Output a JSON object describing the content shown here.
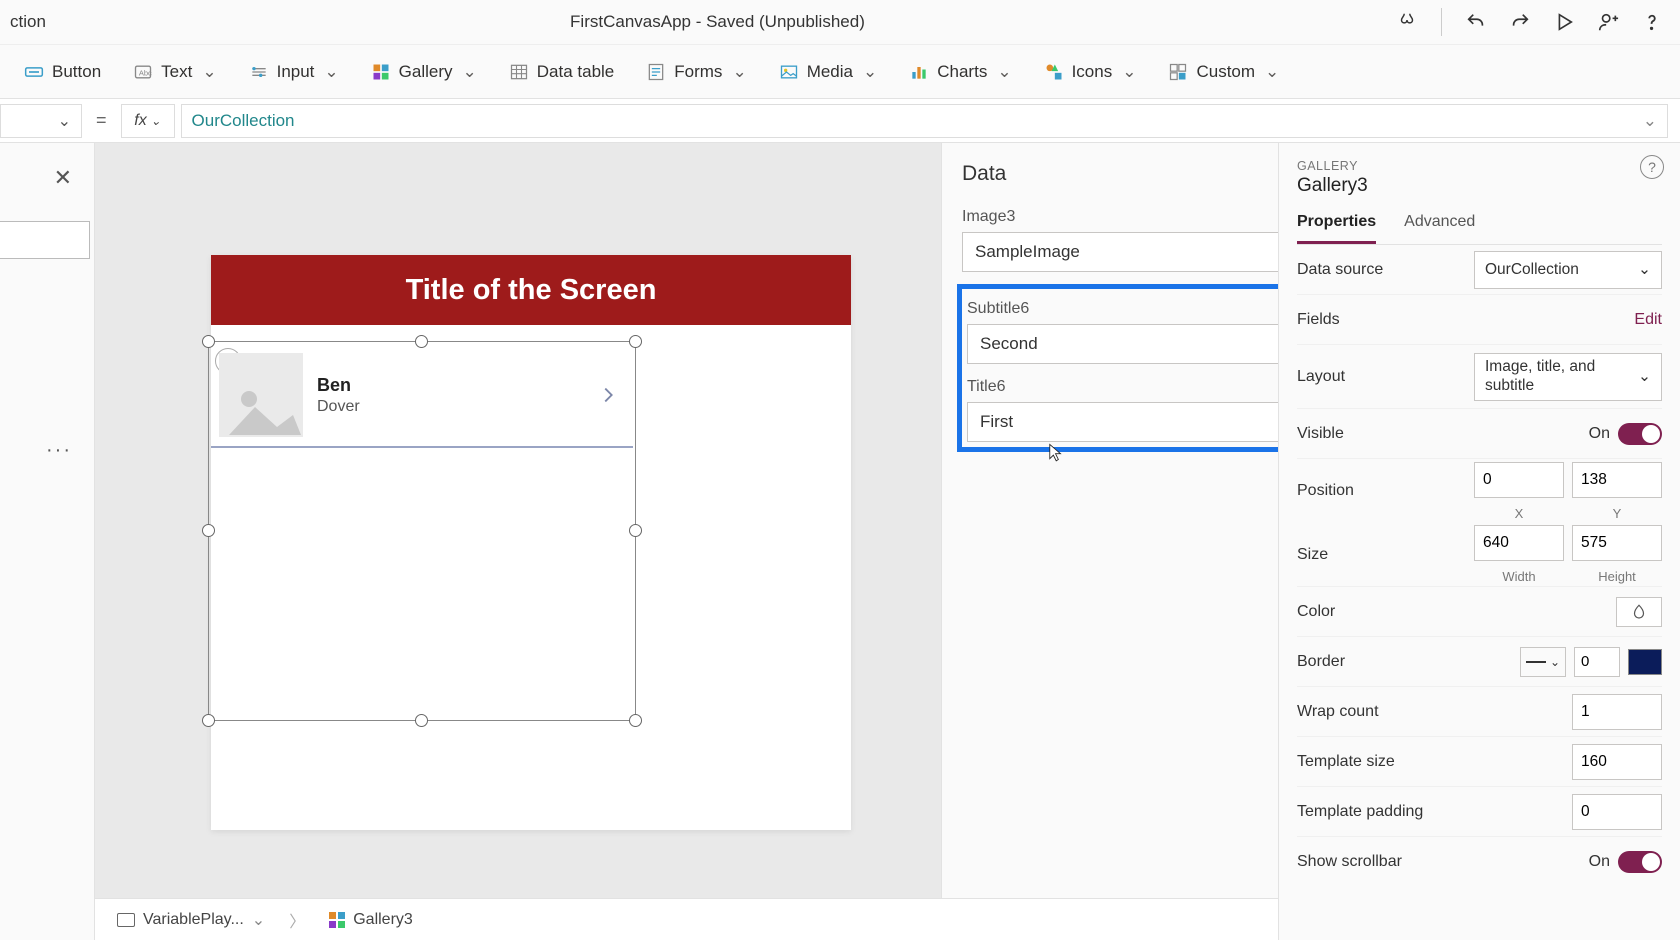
{
  "titlebar": {
    "left": "ction",
    "center": "FirstCanvasApp - Saved (Unpublished)"
  },
  "ribbon": {
    "button": "Button",
    "text": "Text",
    "input": "Input",
    "gallery": "Gallery",
    "datatable": "Data table",
    "forms": "Forms",
    "media": "Media",
    "charts": "Charts",
    "icons": "Icons",
    "custom": "Custom"
  },
  "formula": {
    "fx": "fx",
    "equals": "=",
    "value": "OurCollection"
  },
  "canvas": {
    "app_title": "Title of the Screen",
    "item_title": "Ben",
    "item_subtitle": "Dover"
  },
  "data_panel": {
    "title": "Data",
    "image_label": "Image3",
    "image_value": "SampleImage",
    "subtitle_label": "Subtitle6",
    "subtitle_value": "Second",
    "title_label": "Title6",
    "title_value": "First"
  },
  "props": {
    "kicker": "GALLERY",
    "title": "Gallery3",
    "tab_props": "Properties",
    "tab_adv": "Advanced",
    "data_source_label": "Data source",
    "data_source_value": "OurCollection",
    "fields_label": "Fields",
    "fields_action": "Edit",
    "layout_label": "Layout",
    "layout_value": "Image, title, and subtitle",
    "visible_label": "Visible",
    "visible_value": "On",
    "position_label": "Position",
    "pos_x": "0",
    "pos_y": "138",
    "pos_x_label": "X",
    "pos_y_label": "Y",
    "size_label": "Size",
    "size_w": "640",
    "size_h": "575",
    "size_w_label": "Width",
    "size_h_label": "Height",
    "color_label": "Color",
    "border_label": "Border",
    "border_width": "0",
    "wrap_label": "Wrap count",
    "wrap_value": "1",
    "tplsize_label": "Template size",
    "tplsize_value": "160",
    "tplpad_label": "Template padding",
    "tplpad_value": "0",
    "scroll_label": "Show scrollbar",
    "scroll_value": "On"
  },
  "status": {
    "screen": "VariablePlay...",
    "gallery": "Gallery3"
  }
}
